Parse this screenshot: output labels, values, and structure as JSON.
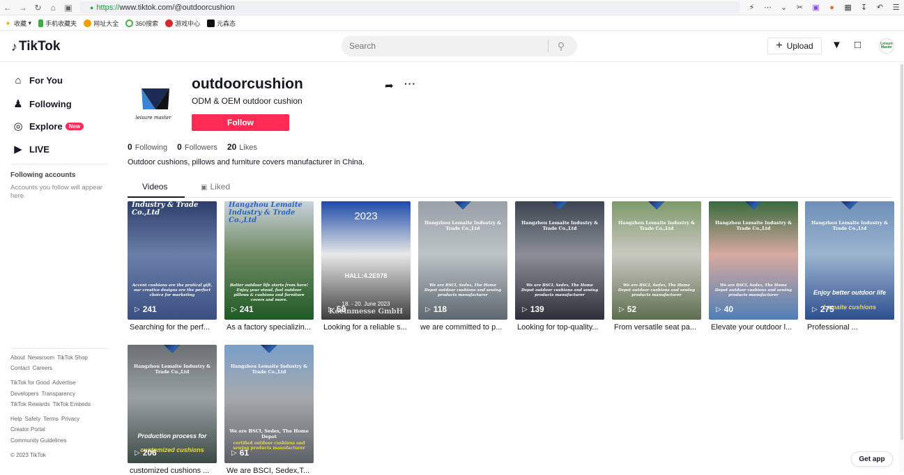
{
  "browser": {
    "url_proto": "https://",
    "url_rest": "www.tiktok.com/@outdoorcushion",
    "bookmarks": [
      "收藏",
      "手机收藏夹",
      "网址大全",
      "360搜索",
      "游戏中心",
      "元森态"
    ]
  },
  "header": {
    "logo_text": "TikTok",
    "search_placeholder": "Search",
    "upload_label": "Upload",
    "avatar_text": "Leisure Master"
  },
  "sidebar": {
    "nav": [
      {
        "label": "For You",
        "icon": "home-icon"
      },
      {
        "label": "Following",
        "icon": "users-icon"
      },
      {
        "label": "Explore",
        "icon": "compass-icon",
        "badge": "New"
      },
      {
        "label": "LIVE",
        "icon": "live-icon"
      }
    ],
    "following_title": "Following accounts",
    "following_text": "Accounts you follow will appear here",
    "footer": [
      [
        "About",
        "Newsroom",
        "TikTok Shop"
      ],
      [
        "Contact",
        "Careers"
      ],
      [
        "TikTok for Good",
        "Advertise"
      ],
      [
        "Developers",
        "Transparency"
      ],
      [
        "TikTok Rewards",
        "TikTok Embeds"
      ],
      [
        "Help",
        "Safety",
        "Terms",
        "Privacy"
      ],
      [
        "Creator Portal"
      ],
      [
        "Community Guidelines"
      ],
      [
        "© 2023 TikTok"
      ]
    ]
  },
  "profile": {
    "username": "outdoorcushion",
    "subtitle": "ODM & OEM outdoor cushion",
    "follow_label": "Follow",
    "avatar_text": "leisure master",
    "stats": [
      {
        "value": "0",
        "label": "Following"
      },
      {
        "value": "0",
        "label": "Followers"
      },
      {
        "value": "20",
        "label": "Likes"
      }
    ],
    "bio": "Outdoor cushions, pillows and furniture covers manufacturer in China.",
    "tabs": {
      "videos": "Videos",
      "liked": "Liked"
    }
  },
  "videos": [
    {
      "views": "241",
      "caption": "Searching for the perf...",
      "overlay_top": "Industry & Trade Co.,Ltd",
      "overlay_text": "Accent cushions are the pratical gift, our creative designs are the perfect choice for marketing",
      "colors": [
        "#2c3f6b",
        "#6a7fa8",
        "#3c4f82"
      ]
    },
    {
      "views": "241",
      "caption": "As a factory specializin...",
      "overlay_top": "Hangzhou Lemaite Industry & Trade Co.,Ltd",
      "overlay_text": "Better outdoor life starts from here! Enjoy your stand, feel outdoor pillows & cushions and furniture covers and more.",
      "colors": [
        "#c9d3dc",
        "#6f8a63",
        "#1f5a25"
      ]
    },
    {
      "views": "58",
      "caption": "Looking for a reliable s...",
      "overlay_top": "2023",
      "overlay_text": "HALL:4.2E078",
      "overlay_sub": "18. - 20. June 2023",
      "overlay_big": "Koelnmesse GmbH",
      "colors": [
        "#1d4aa8",
        "#e8e8e8",
        "#3d3d3d"
      ]
    },
    {
      "views": "118",
      "caption": "we are committed to p...",
      "overlay_top": "Hangzhou Lemaite Industry & Trade Co.,Ltd",
      "overlay_text": "We are BSCI, Sedex, The Home Depot outdoor cushions and sewing products manufacturer",
      "colors": [
        "#9aa0a8",
        "#bcc3c6",
        "#5f6770"
      ]
    },
    {
      "views": "139",
      "caption": "Looking for top-quality...",
      "overlay_top": "Hangzhou Lemaite Industry & Trade Co.,Ltd",
      "overlay_text": "We are BSCI, Sedex, The Home Depot outdoor cushions and sewing products manufacturer",
      "colors": [
        "#3e4450",
        "#8a8f98",
        "#2c3038"
      ]
    },
    {
      "views": "52",
      "caption": "From versatile seat pa...",
      "overlay_top": "Hangzhou Lemaite Industry & Trade Co.,Ltd",
      "overlay_text": "We are BSCI, Sedex, The Home Depot outdoor cushions and sewing products manufacturer",
      "colors": [
        "#7e9a6a",
        "#c9c9c0",
        "#5e6e50"
      ]
    },
    {
      "views": "40",
      "caption": "Elevate your outdoor l...",
      "overlay_top": "Hangzhou Lemaite Industry & Trade Co.,Ltd",
      "overlay_text": "We are BSCI, Sedex, The Home Depot outdoor cushions and sewing products manufacturer",
      "colors": [
        "#3a6a3e",
        "#d8a9a0",
        "#4e7fb5"
      ]
    },
    {
      "views": "275",
      "caption": "Professional ...",
      "overlay_top": "Hangzhou Lemaite Industry & Trade Co.,Ltd",
      "overlay_text": "Enjoy better outdoor life",
      "overlay_sub": "Lemaite cushions",
      "colors": [
        "#6f8fb8",
        "#9bb4cf",
        "#2e4f8f"
      ]
    },
    {
      "views": "206",
      "caption": "customized cushions ...",
      "overlay_top": "Hangzhou Lemaite Industry & Trade Co.,Ltd",
      "overlay_text": "Production process for",
      "overlay_sub": "customized cushions",
      "colors": [
        "#6b7075",
        "#9aa1a4",
        "#3c4a46"
      ]
    },
    {
      "views": "61",
      "caption": "We are BSCI, Sedex,T...",
      "overlay_top": "Hangzhou Lemaite Industry & Trade Co.,Ltd",
      "overlay_text": "We are BSCI, Sedex, The Home Depot",
      "overlay_sub": "certified outdoor cushions and sewing products manufacturer",
      "colors": [
        "#7a9fc9",
        "#a5a9ad",
        "#5d6167"
      ]
    }
  ],
  "get_app_label": "Get app"
}
